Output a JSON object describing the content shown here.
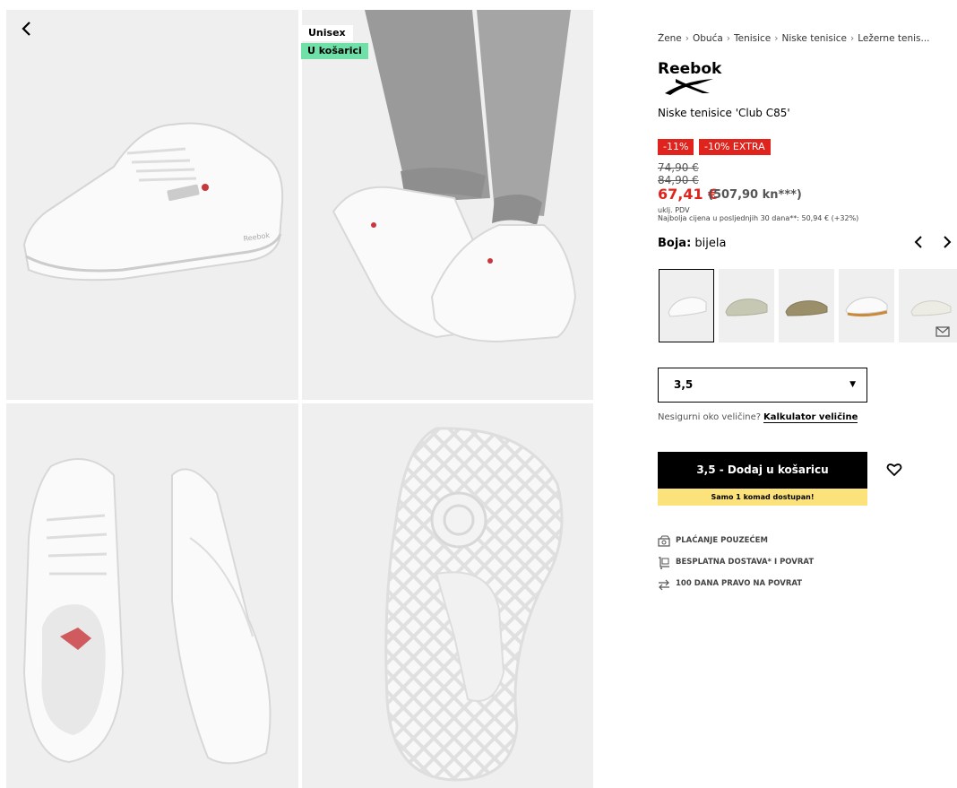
{
  "badges": {
    "unisex": "Unisex",
    "in_cart": "U košarici"
  },
  "breadcrumb": [
    "Žene",
    "Obuća",
    "Tenisice",
    "Niske tenisice",
    "Ležerne tenis..."
  ],
  "brand": "Reebok",
  "product_name": "Niske tenisice 'Club C85'",
  "discounts": [
    "-11%",
    "-10% EXTRA"
  ],
  "prices": {
    "old_price_1": "74,90 €",
    "old_price_2": "84,90 €",
    "current": "67,41 €",
    "current_kn": "(507,90 kn***)",
    "vat_note": "uklj. PDV",
    "lowest_note": "Najbolja cijena u posljednjih 30 dana**: 50,94 € (+32%)"
  },
  "color": {
    "label": "Boja:",
    "value": "bijela"
  },
  "size": {
    "selected": "3,5",
    "help_text": "Nesigurni oko veličine?",
    "calculator_link": "Kalkulator veličine"
  },
  "cart": {
    "button_label": "3,5 - Dodaj u košaricu",
    "stock_note": "Samo 1 komad dostupan!"
  },
  "usps": [
    "PLAĆANJE POUZEĆEM",
    "BESPLATNA DOSTAVA* I POVRAT",
    "100 DANA PRAVO NA POVRAT"
  ],
  "icons": {
    "back": "chevron-left-icon",
    "heart": "heart-icon",
    "mail": "mail-icon"
  },
  "colors": {
    "sale_red": "#e0231c",
    "cart_badge_green": "#6fe0a8",
    "stock_yellow": "#fbe27b"
  }
}
